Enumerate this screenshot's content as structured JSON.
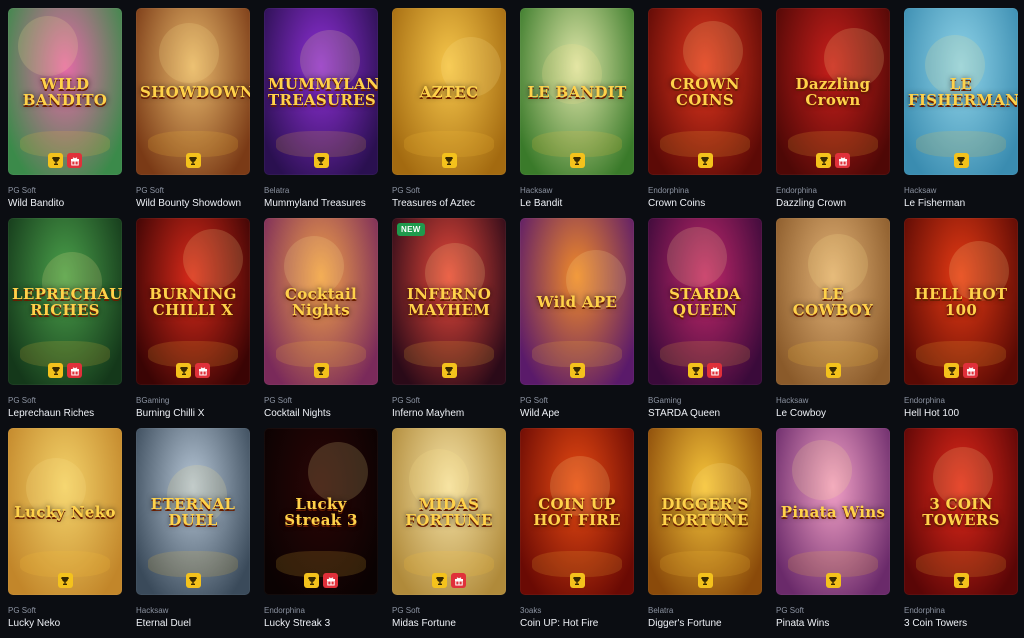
{
  "games": [
    {
      "title": "Wild Bandito",
      "provider": "PG Soft",
      "art": "WILD BANDITO",
      "bg": [
        "#e66aa8",
        "#3b8a4a"
      ],
      "trophy": true,
      "gift": true,
      "new": false
    },
    {
      "title": "Wild Bounty Showdown",
      "provider": "PG Soft",
      "art": "SHOWDOWN",
      "bg": [
        "#e9b96c",
        "#7a3a16"
      ],
      "trophy": true,
      "gift": false,
      "new": false
    },
    {
      "title": "Mummyland Treasures",
      "provider": "Belatra",
      "art": "MUMMYLAND TREASURES",
      "bg": [
        "#8e2fd6",
        "#2a1050"
      ],
      "trophy": true,
      "gift": false,
      "new": false
    },
    {
      "title": "Treasures of Aztec",
      "provider": "PG Soft",
      "art": "AZTEC",
      "bg": [
        "#f6c64a",
        "#a36a10"
      ],
      "trophy": true,
      "gift": false,
      "new": false
    },
    {
      "title": "Le Bandit",
      "provider": "Hacksaw",
      "art": "LE BANDIT",
      "bg": [
        "#dfe6a8",
        "#3a7a2a"
      ],
      "trophy": true,
      "gift": false,
      "new": false
    },
    {
      "title": "Crown Coins",
      "provider": "Endorphina",
      "art": "CROWN COINS",
      "bg": [
        "#e2361e",
        "#5c0a06"
      ],
      "trophy": true,
      "gift": false,
      "new": false
    },
    {
      "title": "Dazzling Crown",
      "provider": "Endorphina",
      "art": "Dazzling Crown",
      "bg": [
        "#c81f1b",
        "#4e0806"
      ],
      "trophy": true,
      "gift": true,
      "new": false
    },
    {
      "title": "Le Fisherman",
      "provider": "Hacksaw",
      "art": "LE FISHERMAN",
      "bg": [
        "#8fd3e8",
        "#3a8cb0"
      ],
      "trophy": true,
      "gift": false,
      "new": false
    },
    {
      "title": "Leprechaun Riches",
      "provider": "PG Soft",
      "art": "LEPRECHAUN RICHES",
      "bg": [
        "#4aa04a",
        "#14381a"
      ],
      "trophy": true,
      "gift": true,
      "new": false
    },
    {
      "title": "Burning Chilli X",
      "provider": "BGaming",
      "art": "BURNING CHILLI X",
      "bg": [
        "#d92a1a",
        "#3a0404"
      ],
      "trophy": true,
      "gift": true,
      "new": false
    },
    {
      "title": "Cocktail Nights",
      "provider": "PG Soft",
      "art": "Cocktail Nights",
      "bg": [
        "#f2a24a",
        "#7a2a5a"
      ],
      "trophy": true,
      "gift": false,
      "new": false
    },
    {
      "title": "Inferno Mayhem",
      "provider": "PG Soft",
      "art": "INFERNO MAYHEM",
      "bg": [
        "#e8483a",
        "#2a0a18"
      ],
      "trophy": true,
      "gift": false,
      "new": true
    },
    {
      "title": "Wild Ape",
      "provider": "PG Soft",
      "art": "Wild APE",
      "bg": [
        "#f08a2a",
        "#5a1a6a"
      ],
      "trophy": true,
      "gift": false,
      "new": false
    },
    {
      "title": "STARDA Queen",
      "provider": "BGaming",
      "art": "STARDA QUEEN",
      "bg": [
        "#c2286a",
        "#3a0a3a"
      ],
      "trophy": true,
      "gift": true,
      "new": false
    },
    {
      "title": "Le Cowboy",
      "provider": "Hacksaw",
      "art": "LE COWBOY",
      "bg": [
        "#e2b276",
        "#8a5a2a"
      ],
      "trophy": true,
      "gift": false,
      "new": false
    },
    {
      "title": "Hell Hot 100",
      "provider": "Endorphina",
      "art": "HELL HOT 100",
      "bg": [
        "#e63a14",
        "#5a0a04"
      ],
      "trophy": true,
      "gift": true,
      "new": false
    },
    {
      "title": "Lucky Neko",
      "provider": "PG Soft",
      "art": "Lucky Neko",
      "bg": [
        "#f4d36a",
        "#c2862a"
      ],
      "trophy": true,
      "gift": false,
      "new": false
    },
    {
      "title": "Eternal Duel",
      "provider": "Hacksaw",
      "art": "ETERNAL DUEL",
      "bg": [
        "#b6c6d6",
        "#3a4a5a"
      ],
      "trophy": true,
      "gift": false,
      "new": false
    },
    {
      "title": "Lucky Streak 3",
      "provider": "Endorphina",
      "art": "Lucky Streak 3",
      "bg": [
        "#2a0606",
        "#0a0202"
      ],
      "trophy": true,
      "gift": true,
      "new": false
    },
    {
      "title": "Midas Fortune",
      "provider": "PG Soft",
      "art": "MIDAS FORTUNE",
      "bg": [
        "#f6e3a6",
        "#b08a3a"
      ],
      "trophy": true,
      "gift": true,
      "new": false
    },
    {
      "title": "Coin UP: Hot Fire",
      "provider": "3oaks",
      "art": "COIN UP HOT FIRE",
      "bg": [
        "#e84a12",
        "#6a0a04"
      ],
      "trophy": true,
      "gift": false,
      "new": false
    },
    {
      "title": "Digger's Fortune",
      "provider": "Belatra",
      "art": "DIGGER'S FORTUNE",
      "bg": [
        "#f6c43a",
        "#8a4a0a"
      ],
      "trophy": true,
      "gift": false,
      "new": false
    },
    {
      "title": "Pinata Wins",
      "provider": "PG Soft",
      "art": "Pinata Wins",
      "bg": [
        "#f2a0c6",
        "#6a2a6a"
      ],
      "trophy": true,
      "gift": false,
      "new": false
    },
    {
      "title": "3 Coin Towers",
      "provider": "Endorphina",
      "art": "3 COIN TOWERS",
      "bg": [
        "#e2281a",
        "#5a0606"
      ],
      "trophy": true,
      "gift": false,
      "new": false
    }
  ],
  "labels": {
    "new": "NEW"
  },
  "colors": {
    "trophy": "#f4c21c",
    "gift": "#e0303a",
    "background": "#0b0d12"
  }
}
